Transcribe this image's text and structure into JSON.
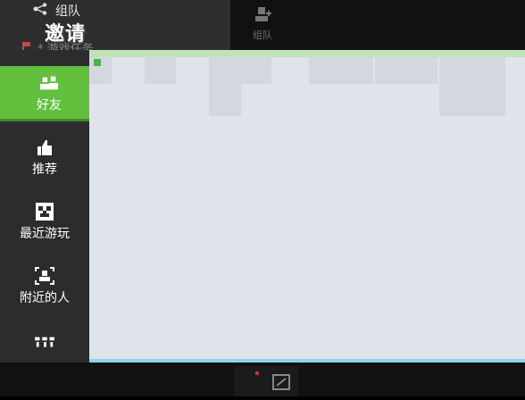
{
  "background": {
    "team_link_label": "组队",
    "team_button_label": "组队",
    "task_label": "* 游戏任务"
  },
  "dialog": {
    "title": "邀请",
    "tabs": [
      {
        "label": "好友",
        "icon": "friends-icon",
        "active": true
      },
      {
        "label": "推荐",
        "icon": "thumbs-up-icon",
        "active": false
      },
      {
        "label": "最近游玩",
        "icon": "creeper-face-icon",
        "active": false
      },
      {
        "label": "附近的人",
        "icon": "nearby-people-icon",
        "active": false
      },
      {
        "label": "",
        "icon": "more-icon",
        "active": false
      }
    ]
  },
  "colors": {
    "active_tab": "#63c03f",
    "sidebar_bg": "#2c2c2e",
    "content_bg": "#dfe3ea",
    "accent_line": "#8fd3f0"
  }
}
